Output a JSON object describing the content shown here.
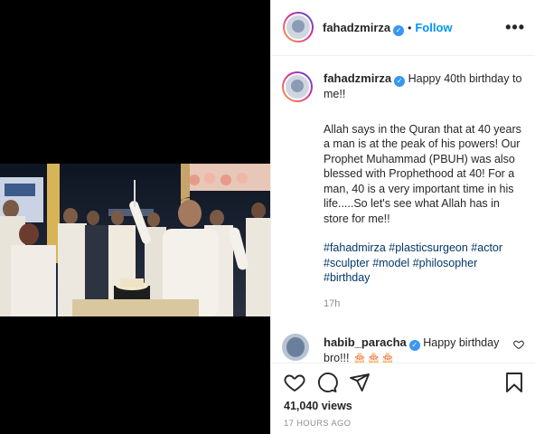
{
  "post": {
    "username": "fahadzmirza",
    "follow_label": "Follow",
    "separator": "•",
    "more_label": "•••"
  },
  "caption": {
    "username": "fahadzmirza",
    "line1": "Happy 40th birthday to me!!",
    "paragraph": "Allah says in the Quran that at 40 years a man is at the peak of his powers! Our Prophet Muhammad (PBUH) was also blessed with Prophethood at 40! For a man, 40 is a very important time in his life.....So let's see what Allah has in store for me!!",
    "hashtags": "#fahadmirza #plasticsurgeon #actor #sculpter #model #philosopher #birthday",
    "time": "17h"
  },
  "reply": {
    "username": "habib_paracha",
    "text": "Happy birthday bro!!! 🎂🎂🎂"
  },
  "actions": {
    "views": "41,040 views",
    "timestamp": "17 HOURS AGO"
  },
  "icons": {
    "like": "heart-icon",
    "comment": "comment-icon",
    "share": "paper-plane-icon",
    "save": "bookmark-icon",
    "options": "more-options-icon"
  },
  "colors": {
    "link": "#0095f6",
    "hashtag": "#00376b",
    "verified": "#3897f0",
    "muted": "#8e8e8e"
  }
}
